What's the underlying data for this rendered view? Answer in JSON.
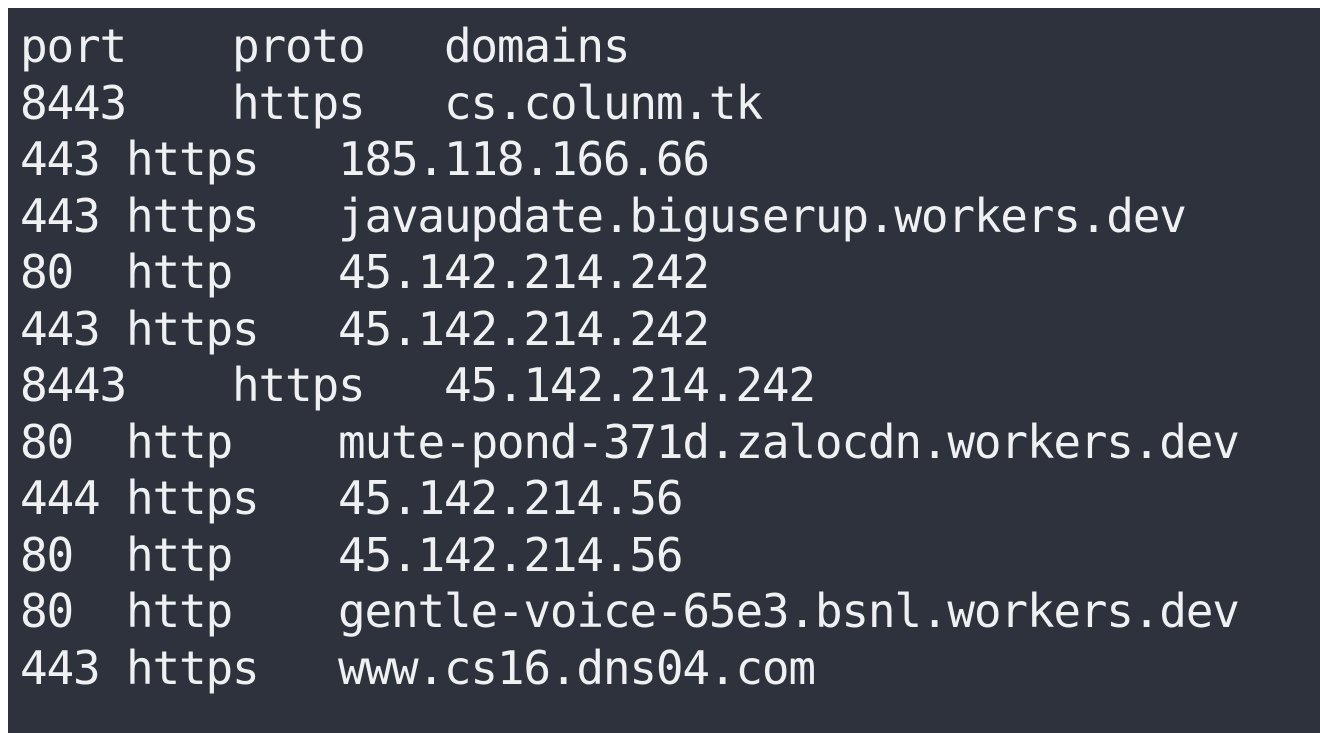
{
  "terminal": {
    "header": {
      "port": "port",
      "proto": "proto",
      "domain": "domains",
      "sep1": "    ",
      "sep2": "   "
    },
    "rows": [
      {
        "port": "8443",
        "sep1": "    ",
        "proto": "https",
        "sep2": "   ",
        "domain": "cs.colunm.tk"
      },
      {
        "port": "443",
        "sep1": " ",
        "proto": "https",
        "sep2": "   ",
        "domain": "185.118.166.66"
      },
      {
        "port": "443",
        "sep1": " ",
        "proto": "https",
        "sep2": "   ",
        "domain": "javaupdate.biguserup.workers.dev"
      },
      {
        "port": "80",
        "sep1": "  ",
        "proto": "http",
        "sep2": "    ",
        "domain": "45.142.214.242"
      },
      {
        "port": "443",
        "sep1": " ",
        "proto": "https",
        "sep2": "   ",
        "domain": "45.142.214.242"
      },
      {
        "port": "8443",
        "sep1": "    ",
        "proto": "https",
        "sep2": "   ",
        "domain": "45.142.214.242"
      },
      {
        "port": "80",
        "sep1": "  ",
        "proto": "http",
        "sep2": "    ",
        "domain": "mute-pond-371d.zalocdn.workers.dev"
      },
      {
        "port": "444",
        "sep1": " ",
        "proto": "https",
        "sep2": "   ",
        "domain": "45.142.214.56"
      },
      {
        "port": "80",
        "sep1": "  ",
        "proto": "http",
        "sep2": "    ",
        "domain": "45.142.214.56"
      },
      {
        "port": "80",
        "sep1": "  ",
        "proto": "http",
        "sep2": "    ",
        "domain": "gentle-voice-65e3.bsnl.workers.dev"
      },
      {
        "port": "443",
        "sep1": " ",
        "proto": "https",
        "sep2": "   ",
        "domain": "www.cs16.dns04.com"
      }
    ]
  }
}
